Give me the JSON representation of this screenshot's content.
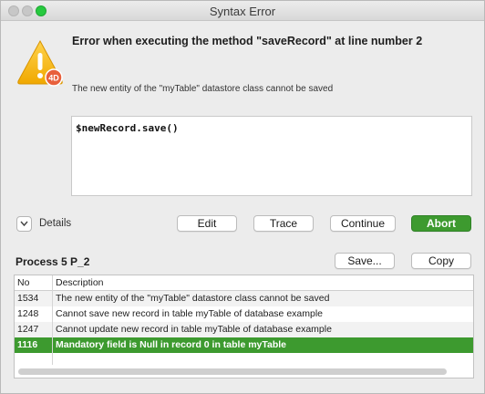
{
  "window": {
    "title": "Syntax Error"
  },
  "error": {
    "title": "Error when executing the method \"saveRecord\" at line number 2",
    "description": "The new entity of the \"myTable\" datastore class cannot be saved",
    "code": "$newRecord.save()",
    "icon": "warning-triangle-icon",
    "badge": "4D"
  },
  "details": {
    "label": "Details"
  },
  "actions": {
    "edit": "Edit",
    "trace": "Trace",
    "continue": "Continue",
    "abort": "Abort"
  },
  "process": {
    "label": "Process 5 P_2",
    "save": "Save...",
    "copy": "Copy"
  },
  "table": {
    "columns": [
      "No",
      "Description"
    ],
    "rows": [
      {
        "no": "1534",
        "desc": "The new entity of the \"myTable\" datastore class cannot be saved"
      },
      {
        "no": "1248",
        "desc": "Cannot save new record in table myTable of database example"
      },
      {
        "no": "1247",
        "desc": "Cannot update new record in table myTable of database example"
      },
      {
        "no": "1116",
        "desc": "Mandatory field is Null in record 0 in table myTable",
        "selected": true
      }
    ]
  },
  "colors": {
    "accent": "#3d9a2f",
    "warning": "#f5b400",
    "badge": "#e8603c"
  }
}
